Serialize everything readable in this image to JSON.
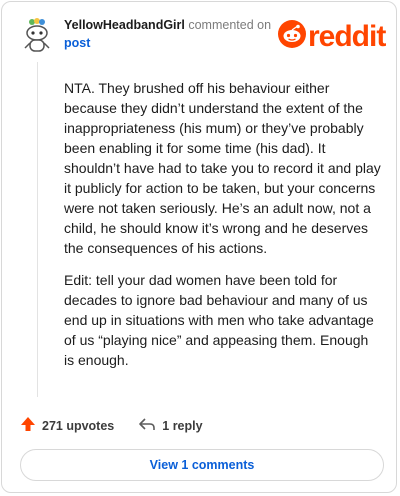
{
  "comment": {
    "username": "YellowHeadbandGirl",
    "commented_on": "commented on",
    "post_link": "post",
    "paragraphs": [
      "NTA. They brushed off his behaviour either because they didn’t understand the extent of the inappropriateness (his mum) or they’ve probably been enabling it for some time (his dad). It shouldn’t have had to take you to record it and play it publicly for action to be taken, but your concerns were not taken seriously. He’s an adult now, not a child, he should know it’s wrong and he deserves the consequences of his actions.",
      "Edit: tell your dad women have been told for decades to ignore bad behaviour and many of us end up in situations with men who take advantage of us “playing nice” and appeasing them. Enough is enough."
    ],
    "upvotes_label": "271 upvotes",
    "replies_label": "1 reply",
    "view_comments_label": "View 1 comments"
  },
  "branding": {
    "logo_text": "reddit",
    "brand_color": "#ff4500",
    "link_color": "#0a5fd8"
  },
  "icons": {
    "avatar": "snoo-avatar-icon",
    "logo": "reddit-snoo-icon",
    "upvote": "upvote-arrow-icon",
    "reply": "reply-arrow-icon"
  }
}
